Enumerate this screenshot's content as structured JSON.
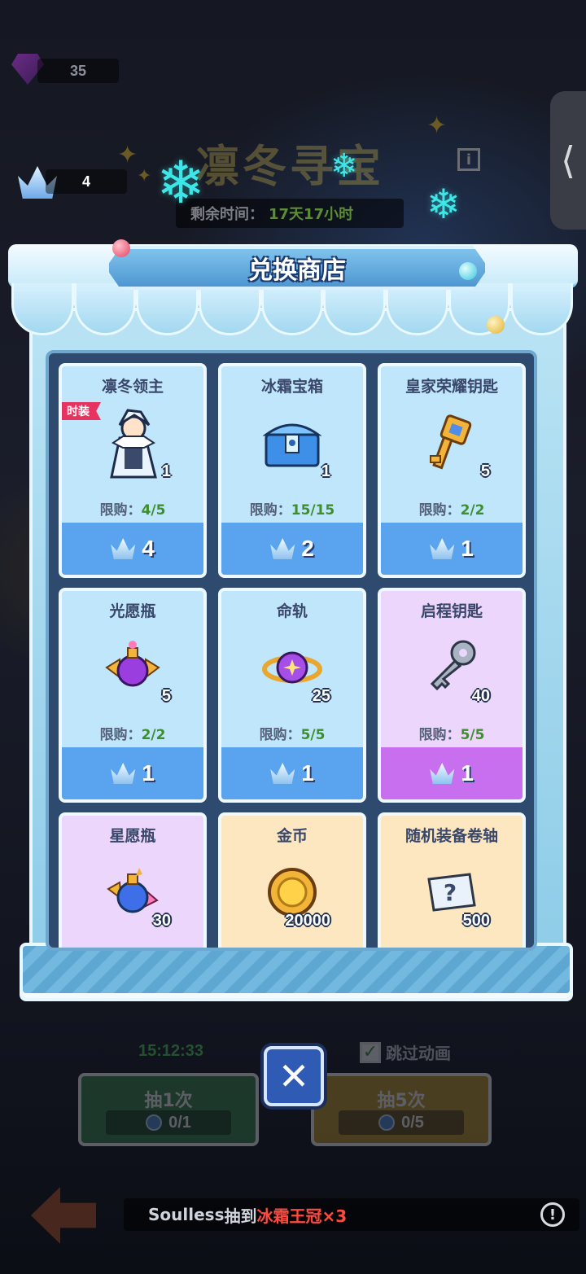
{
  "resources": {
    "gems": "35",
    "crowns": "4"
  },
  "event": {
    "title": "凛冬寻宝",
    "time_label": "剩余时间：",
    "time_value": "17天17小时"
  },
  "shop": {
    "title": "兑换商店",
    "limit_label": "限购：",
    "items": [
      {
        "name": "凛冬领主",
        "tag": "时装",
        "qty": "1",
        "limit": "4/5",
        "price": "4",
        "theme": "blue",
        "icon": "frost-lord-character-icon"
      },
      {
        "name": "冰霜宝箱",
        "qty": "1",
        "limit": "15/15",
        "price": "2",
        "theme": "blue",
        "icon": "frost-chest-icon"
      },
      {
        "name": "皇家荣耀钥匙",
        "qty": "5",
        "limit": "2/2",
        "price": "1",
        "theme": "blue",
        "icon": "gold-key-icon"
      },
      {
        "name": "光愿瓶",
        "qty": "5",
        "limit": "2/2",
        "price": "1",
        "theme": "blue",
        "icon": "light-wish-bottle-icon"
      },
      {
        "name": "命轨",
        "qty": "25",
        "limit": "5/5",
        "price": "1",
        "theme": "blue",
        "icon": "fate-orb-icon"
      },
      {
        "name": "启程钥匙",
        "qty": "40",
        "limit": "5/5",
        "price": "1",
        "theme": "purple",
        "icon": "silver-key-icon"
      },
      {
        "name": "星愿瓶",
        "qty": "30",
        "theme": "purple",
        "icon": "star-wish-bottle-icon"
      },
      {
        "name": "金币",
        "qty": "20000",
        "theme": "orange",
        "icon": "gold-coin-icon"
      },
      {
        "name": "随机装备卷轴",
        "qty": "500",
        "theme": "orange",
        "icon": "mystery-scroll-icon"
      }
    ]
  },
  "controls": {
    "countdown": "15:12:33",
    "skip_animation": "跳过动画",
    "draw_one": {
      "label": "抽1次",
      "cost": "0/1"
    },
    "draw_five": {
      "label": "抽5次",
      "cost": "0/5"
    },
    "close_glyph": "✕"
  },
  "ticker": {
    "player": "Soulless",
    "verb": "抽到",
    "reward": "冰霜王冠×3",
    "alert_glyph": "!"
  },
  "colors": {
    "card_blue": "#bfe6fb",
    "card_purple": "#ecd6fb",
    "card_orange": "#fde7c1",
    "price_blue": "#5aa3ee",
    "price_purple": "#c86ff0",
    "limit_green": "#3d8f2a"
  }
}
